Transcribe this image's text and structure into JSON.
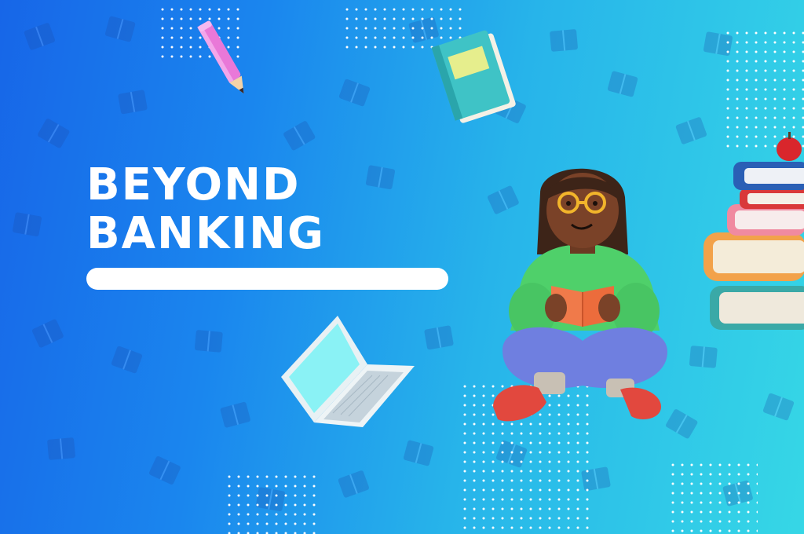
{
  "headline": {
    "line1": "BEYOND",
    "line2": "BANKING"
  },
  "colors": {
    "gradient_start": "#1766e8",
    "gradient_end": "#36d7e6",
    "text": "#ffffff",
    "sweater": "#4fd06a",
    "pants": "#6f7fe0",
    "shoes": "#e2483e",
    "book_orange": "#f07a4a",
    "book_teal": "#3fc3c6"
  },
  "illustrations": [
    "pencil-icon",
    "book-icon",
    "laptop-icon",
    "reading-person-figure",
    "book-stack-icon",
    "apple-icon"
  ]
}
